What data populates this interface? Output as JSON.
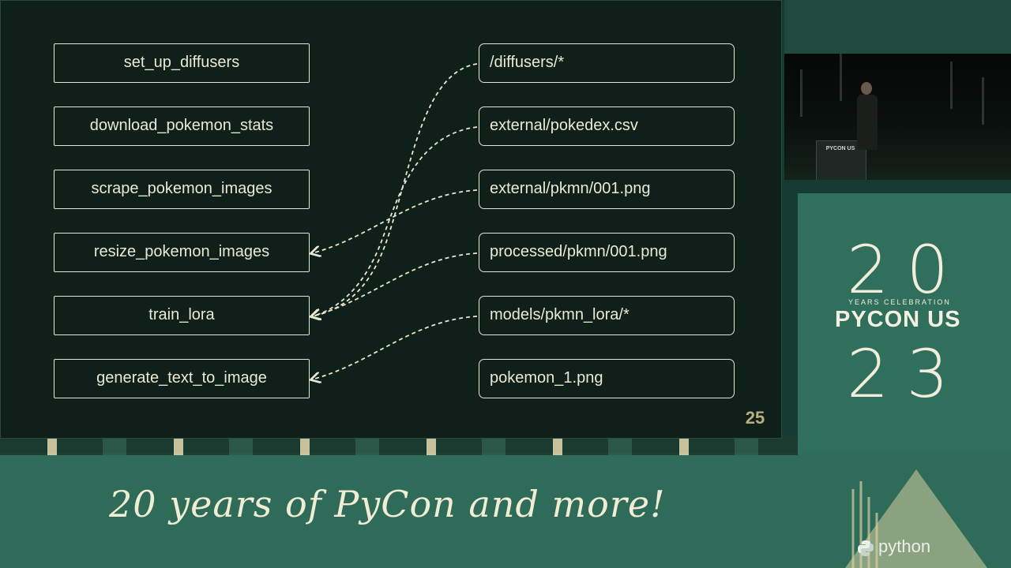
{
  "slide": {
    "left_boxes": [
      "set_up_diffusers",
      "download_pokemon_stats",
      "scrape_pokemon_images",
      "resize_pokemon_images",
      "train_lora",
      "generate_text_to_image"
    ],
    "right_boxes": [
      "/diffusers/*",
      "external/pokedex.csv",
      "external/pkmn/001.png",
      "processed/pkmn/001.png",
      "models/pkmn_lora/*",
      "pokemon_1.png"
    ],
    "slide_number": "25"
  },
  "event": {
    "year_top": "20",
    "year_sub": "YEARS CELEBRATION",
    "name": "PYCON US",
    "year_bottom": "23",
    "tagline": "20 years of PyCon and more!",
    "podium_label": "PYCON US",
    "sponsor": "python"
  },
  "colors": {
    "slide_bg": "#0f1f19",
    "box_border": "#e8e6cf",
    "slide_number": "#b9b07a",
    "event_green": "#2f6a58"
  }
}
